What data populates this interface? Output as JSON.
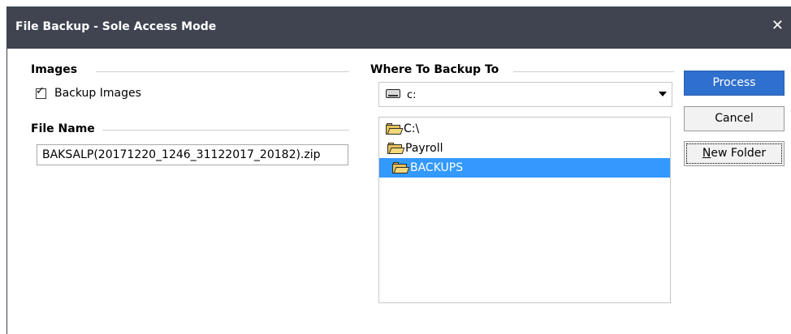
{
  "window": {
    "title": "File Backup - Sole Access Mode"
  },
  "images_group": {
    "title": "Images",
    "backup_images_label": "Backup Images",
    "backup_images_checked": true
  },
  "file_name_group": {
    "title": "File Name",
    "value": "BAKSALP(20171220_1246_31122017_20182).zip"
  },
  "backup_to_group": {
    "title": "Where To Backup To",
    "drive": {
      "value": "c:",
      "icon": "drive-icon"
    },
    "folders": [
      {
        "label": "C:\\",
        "icon": "open-folder-icon",
        "selected": false
      },
      {
        "label": "Payroll",
        "icon": "open-folder-icon",
        "selected": false
      },
      {
        "label": "BACKUPS",
        "icon": "open-folder-icon",
        "selected": true
      }
    ]
  },
  "buttons": {
    "process": "Process",
    "cancel": "Cancel",
    "new_folder_n": "N",
    "new_folder_rest": "ew Folder"
  },
  "colors": {
    "titlebar": "#3f4450",
    "accent": "#2f6fcd",
    "selection": "#3399ff"
  }
}
